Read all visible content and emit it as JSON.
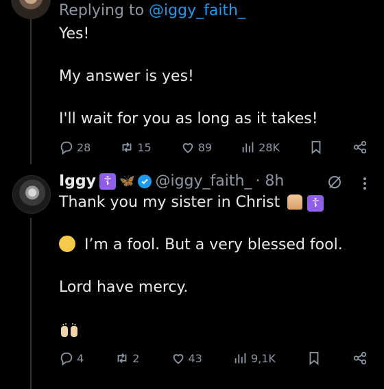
{
  "first_tweet": {
    "replying_prefix": "Replying to",
    "replying_handle": "@iggy_faith_",
    "lines": [
      "Yes!",
      "My answer is yes!",
      "I'll wait for you as long as it takes!"
    ],
    "actions": {
      "replies": "28",
      "reposts": "15",
      "likes": "89",
      "views": "28K"
    }
  },
  "second_tweet": {
    "display_name": "Iggy",
    "handle": "@iggy_faith_",
    "time": "· 8h",
    "line1": "Thank you my sister in Christ",
    "line2": "I’m a fool. But a very blessed fool.",
    "line3": "Lord have mercy.",
    "actions": {
      "replies": "4",
      "reposts": "2",
      "likes": "43",
      "views": "9,1K"
    }
  },
  "colors": {
    "background": "#000000",
    "text": "#e7e9ea",
    "muted": "#8b98a5",
    "accent": "#1d9bf0"
  }
}
